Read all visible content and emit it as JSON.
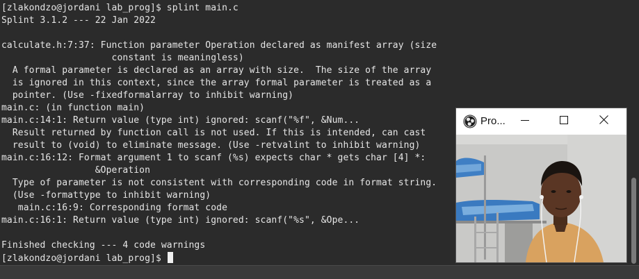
{
  "terminal": {
    "lines": [
      "[zlakondzo@jordani lab_prog]$ splint main.c",
      "Splint 3.1.2 --- 22 Jan 2022",
      "",
      "calculate.h:7:37: Function parameter Operation declared as manifest array (size",
      "                    constant is meaningless)",
      "  A formal parameter is declared as an array with size.  The size of the array",
      "  is ignored in this context, since the array formal parameter is treated as a",
      "  pointer. (Use -fixedformalarray to inhibit warning)",
      "main.c: (in function main)",
      "main.c:14:1: Return value (type int) ignored: scanf(\"%f\", &Num...",
      "  Result returned by function call is not used. If this is intended, can cast",
      "  result to (void) to eliminate message. (Use -retvalint to inhibit warning)",
      "main.c:16:12: Format argument 1 to scanf (%s) expects char * gets char [4] *:",
      "                 &Operation",
      "  Type of parameter is not consistent with corresponding code in format string.",
      "  (Use -formattype to inhibit warning)",
      "   main.c:16:9: Corresponding format code",
      "main.c:16:1: Return value (type int) ignored: scanf(\"%s\", &Ope...",
      "",
      "Finished checking --- 4 code warnings"
    ],
    "prompt": "[zlakondzo@jordani lab_prog]$ "
  },
  "projector": {
    "title": "Pro...",
    "app_icon": "obs-logo-icon",
    "minimize_icon": "minimize-icon",
    "maximize_icon": "maximize-icon",
    "close_icon": "close-icon"
  },
  "colors": {
    "terminal_bg": "#2b2b2b",
    "terminal_fg": "#e6e6e6",
    "window_bg": "#ffffff"
  }
}
